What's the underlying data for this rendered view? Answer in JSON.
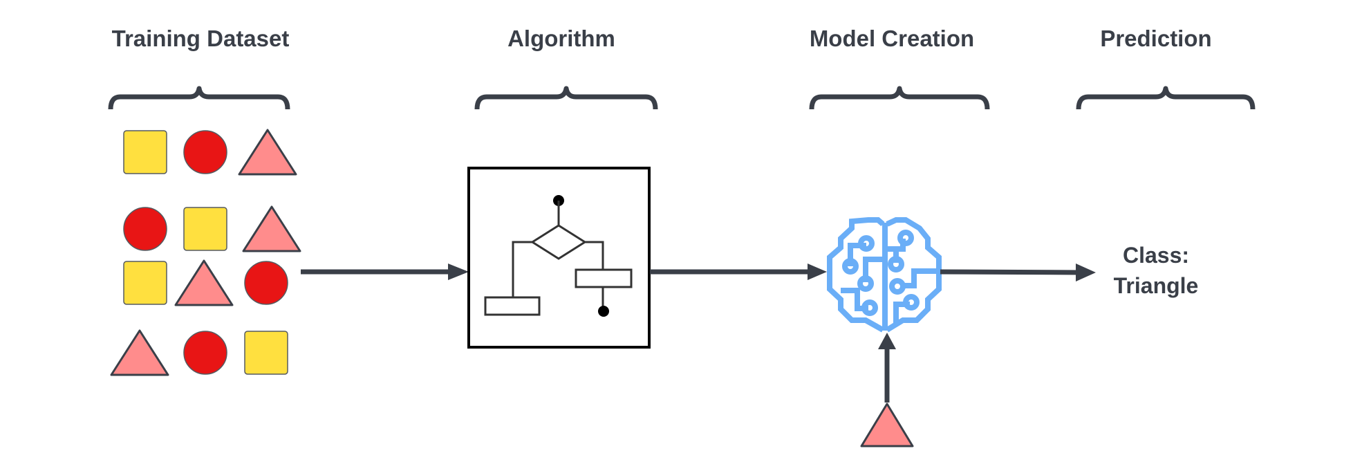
{
  "colors": {
    "text": "#3a3f48",
    "square_fill": "#ffe03f",
    "circle_fill": "#e81515",
    "triangle_fill": "#ff8c8c",
    "brain_stroke": "#6aaef7",
    "box_stroke": "#000000"
  },
  "stages": [
    {
      "id": "training-dataset",
      "label": "Training Dataset"
    },
    {
      "id": "algorithm",
      "label": "Algorithm"
    },
    {
      "id": "model-creation",
      "label": "Model Creation"
    },
    {
      "id": "prediction",
      "label": "Prediction"
    }
  ],
  "training_dataset": {
    "rows": [
      [
        "square",
        "circle",
        "triangle"
      ],
      [
        "circle",
        "square",
        "triangle"
      ],
      [
        "square",
        "triangle",
        "circle"
      ],
      [
        "triangle",
        "circle",
        "square"
      ]
    ]
  },
  "algorithm": {
    "icon": "flowchart-icon"
  },
  "model": {
    "icon": "ai-brain-circuit-icon"
  },
  "input_sample": {
    "shape": "triangle"
  },
  "prediction": {
    "line1": "Class:",
    "line2": "Triangle"
  }
}
